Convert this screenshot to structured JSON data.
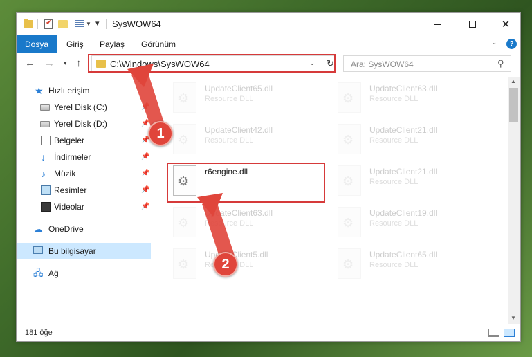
{
  "window": {
    "title": "SysWOW64",
    "controls": {
      "minimize": "—",
      "maximize": "☐",
      "close": "✕"
    }
  },
  "ribbon": {
    "tabs": [
      "Dosya",
      "Giriş",
      "Paylaş",
      "Görünüm"
    ],
    "help": "?"
  },
  "address": {
    "path": "C:\\Windows\\SysWOW64",
    "refresh_glyph": "↻"
  },
  "search": {
    "placeholder": "Ara: SysWOW64",
    "glyph": "⚲"
  },
  "navigation": {
    "back": "←",
    "forward": "→",
    "recent": "⌄",
    "up": "↑"
  },
  "sidebar": {
    "items": [
      {
        "label": "Hızlı erişim",
        "icon": "star-icon"
      },
      {
        "label": "Yerel Disk (C:)",
        "icon": "drive-icon",
        "pinned": true
      },
      {
        "label": "Yerel Disk (D:)",
        "icon": "drive-icon",
        "pinned": true
      },
      {
        "label": "Belgeler",
        "icon": "documents-icon",
        "pinned": true
      },
      {
        "label": "İndirmeler",
        "icon": "download-icon",
        "pinned": true
      },
      {
        "label": "Müzik",
        "icon": "music-icon",
        "pinned": true
      },
      {
        "label": "Resimler",
        "icon": "pictures-icon",
        "pinned": true
      },
      {
        "label": "Videolar",
        "icon": "videos-icon",
        "pinned": true
      },
      {
        "label": "OneDrive",
        "icon": "cloud-icon"
      },
      {
        "label": "Bu bilgisayar",
        "icon": "computer-icon",
        "selected": true
      },
      {
        "label": "Ağ",
        "icon": "network-icon"
      }
    ],
    "pin_glyph": "📌"
  },
  "files": {
    "highlighted": {
      "name": "r6engine.dll",
      "type": ""
    },
    "faded": [
      {
        "name": "UpdateClient65.dll",
        "type": "Resource DLL"
      },
      {
        "name": "UpdateClient63.dll",
        "type": "Resource DLL"
      },
      {
        "name": "UpdateClient42.dll",
        "type": "Resource DLL"
      },
      {
        "name": "UpdateClient21.dll",
        "type": "Resource DLL"
      },
      {
        "name": "UpdateClient21.dll",
        "type": "Resource DLL"
      },
      {
        "name": "UpdateClient63.dll",
        "type": "Resource DLL"
      },
      {
        "name": "UpdateClient19.dll",
        "type": "Resource DLL"
      },
      {
        "name": "UpdateClient5.dll",
        "type": "Resource DLL"
      },
      {
        "name": "UpdateClient65.dll",
        "type": "Resource DLL"
      }
    ]
  },
  "status": {
    "count": "181 öğe"
  },
  "annotations": {
    "step1": "1",
    "step2": "2"
  },
  "colors": {
    "accent": "#1979ca",
    "highlight": "#d63a3a",
    "selection": "#cce8ff"
  }
}
